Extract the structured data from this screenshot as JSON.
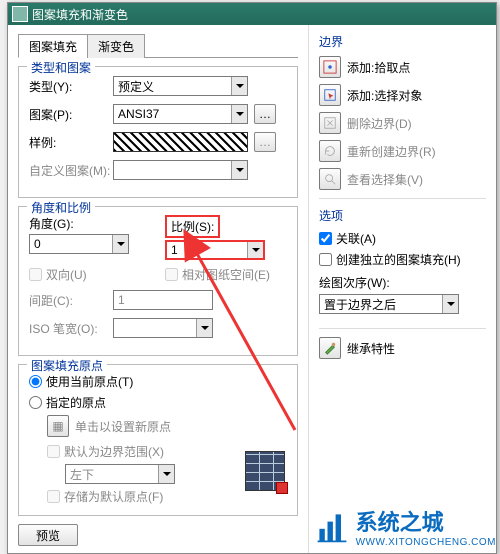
{
  "window_title": "图案填充和渐变色",
  "tabs": {
    "fill": "图案填充",
    "grad": "渐变色"
  },
  "type_pattern": {
    "group": "类型和图案",
    "type_label": "类型(Y):",
    "type_value": "预定义",
    "pattern_label": "图案(P):",
    "pattern_value": "ANSI37",
    "sample_label": "样例:",
    "custom_label": "自定义图案(M):"
  },
  "angle_scale": {
    "group": "角度和比例",
    "angle_label": "角度(G):",
    "angle_value": "0",
    "scale_label": "比例(S):",
    "scale_value": "1",
    "bidir": "双向(U)",
    "relpaper": "相对图纸空间(E)",
    "spacing_label": "间距(C):",
    "spacing_value": "1",
    "iso_label": "ISO 笔宽(O):"
  },
  "origin": {
    "group": "图案填充原点",
    "use_current": "使用当前原点(T)",
    "specified": "指定的原点",
    "click_set": "单击以设置新原点",
    "default_bound": "默认为边界范围(X)",
    "pos_value": "左下",
    "store_default": "存储为默认原点(F)"
  },
  "preview_btn": "预览",
  "boundary": {
    "title": "边界",
    "pick": "添加:拾取点",
    "select": "添加:选择对象",
    "delete": "删除边界(D)",
    "recreate": "重新创建边界(R)",
    "view": "查看选择集(V)"
  },
  "options": {
    "title": "选项",
    "assoc": "关联(A)",
    "indep": "创建独立的图案填充(H)",
    "draworder_label": "绘图次序(W):",
    "draworder_value": "置于边界之后"
  },
  "inherit": "继承特性",
  "watermark": {
    "name": "系统之城",
    "url": "WWW.XITONGCHENG.COM"
  }
}
